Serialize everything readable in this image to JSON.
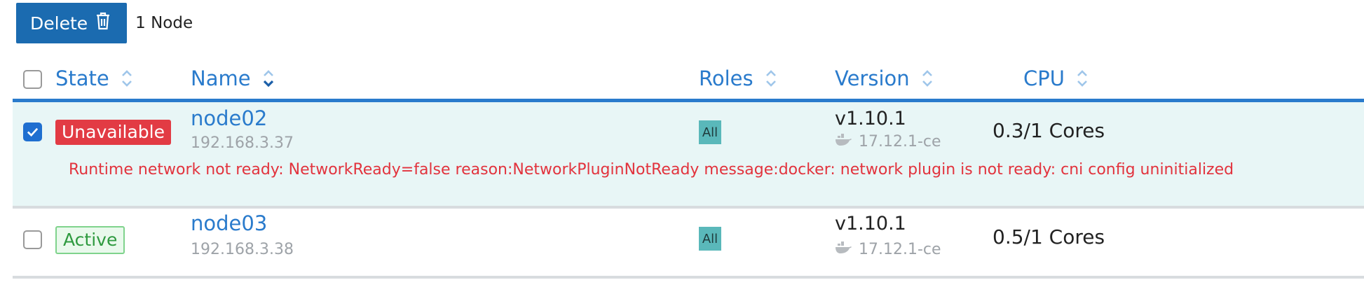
{
  "toolbar": {
    "delete_label": "Delete",
    "selection_count": "1 Node"
  },
  "table": {
    "columns": [
      {
        "label": "State",
        "sort": "both"
      },
      {
        "label": "Name",
        "sort": "desc"
      },
      {
        "label": "Roles",
        "sort": "both"
      },
      {
        "label": "Version",
        "sort": "both"
      },
      {
        "label": "CPU",
        "sort": "both"
      }
    ],
    "rows": [
      {
        "checked": true,
        "state": "Unavailable",
        "name": "node02",
        "ip": "192.168.3.37",
        "role": "All",
        "version": "v1.10.1",
        "docker_version": "17.12.1-ce",
        "cpu": "0.3/1 Cores",
        "message": "Runtime network not ready: NetworkReady=false reason:NetworkPluginNotReady message:docker: network plugin is not ready: cni config uninitialized"
      },
      {
        "checked": false,
        "state": "Active",
        "name": "node03",
        "ip": "192.168.3.38",
        "role": "All",
        "version": "v1.10.1",
        "docker_version": "17.12.1-ce",
        "cpu": "0.5/1 Cores"
      }
    ]
  },
  "colors": {
    "primary": "#1b6bb0",
    "link": "#2a7bcc",
    "error": "#e23b44",
    "success": "#2e9a3f",
    "selected_row_bg": "#e8f6f6"
  },
  "icons": {
    "delete": "trash-icon",
    "sort_both": "sort-icon",
    "sort_desc": "sort-desc-icon",
    "docker": "docker-icon",
    "check": "check-icon"
  }
}
